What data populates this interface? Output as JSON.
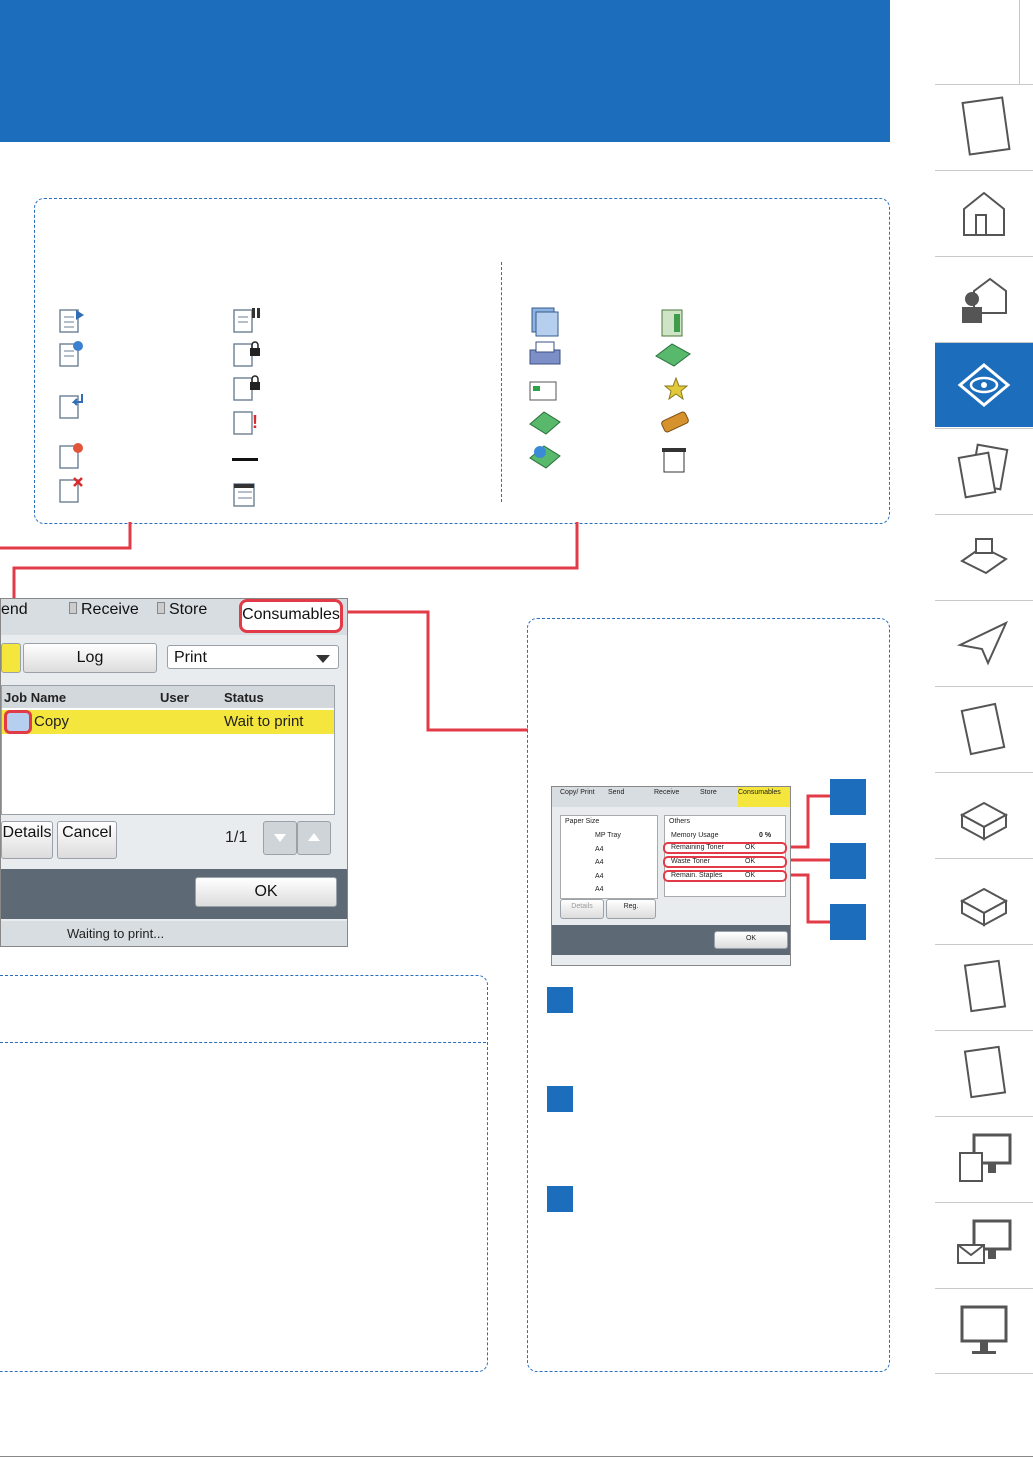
{
  "screen": {
    "tabs": [
      "end",
      "Receive",
      "Store",
      "Consumables"
    ],
    "sub_buttons": [
      "Log",
      "Print"
    ],
    "table_headers": [
      "Job Name",
      "User",
      "Status"
    ],
    "rows": [
      {
        "name": "Copy",
        "status": "Wait to print"
      }
    ],
    "buttons": [
      "Details",
      "Cancel",
      "OK"
    ],
    "page_indicator": "1/1",
    "status_text": "Waiting to print..."
  },
  "mini_screen": {
    "tabs": [
      "Copy/ Print",
      "Send",
      "Receive",
      "Store",
      "Consumables"
    ],
    "paper_size_title": "Paper Size",
    "paper_rows": [
      "MP Tray",
      "A4",
      "A4",
      "A4",
      "A4"
    ],
    "others_title": "Others",
    "memory_usage_label": "Memory Usage",
    "memory_usage_value": "0 %",
    "items": [
      {
        "label": "Remaining Toner",
        "value": "OK"
      },
      {
        "label": "Waste Toner",
        "value": "OK"
      },
      {
        "label": "Remain. Staples",
        "value": "OK"
      }
    ],
    "details": "Details",
    "reg": "Reg.",
    "ok": "OK"
  },
  "colors": {
    "accent": "#1c6dbc",
    "highlight": "#f4e63c",
    "callout": "#e23b47"
  }
}
